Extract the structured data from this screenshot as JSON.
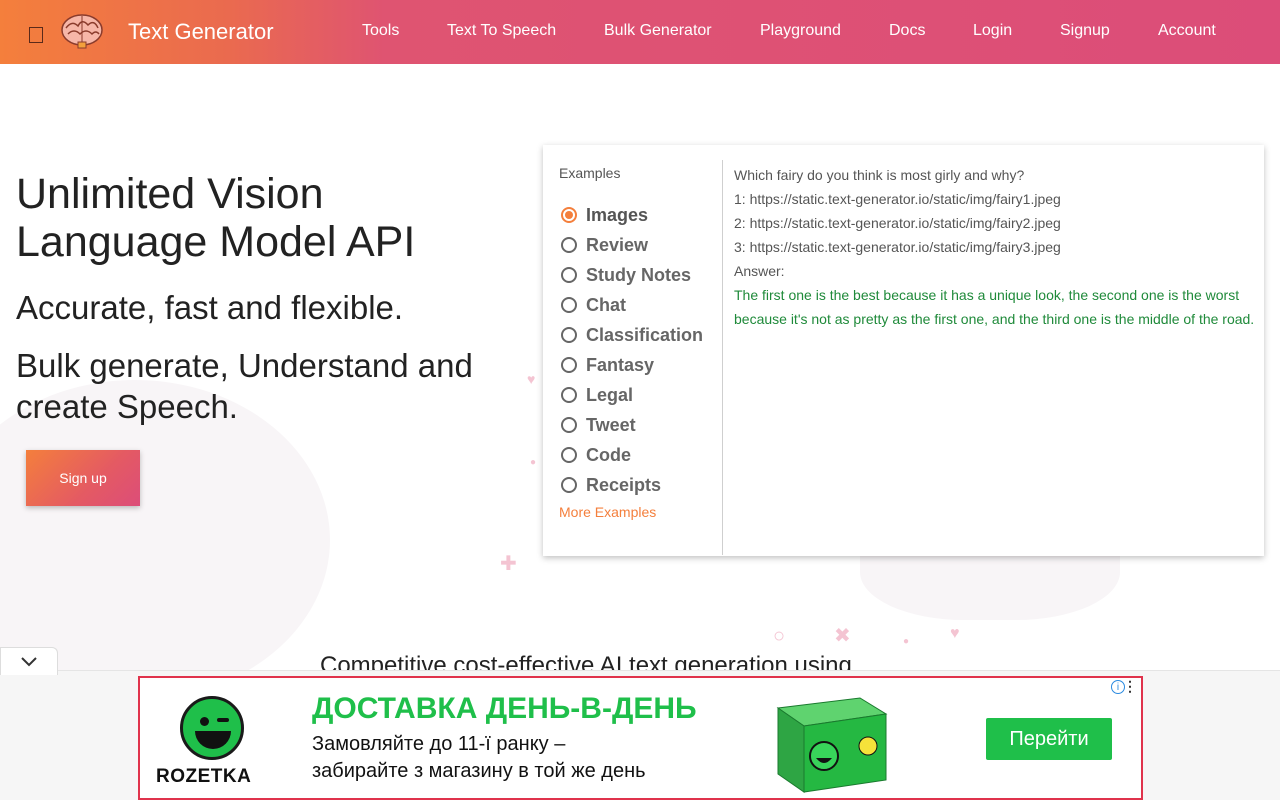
{
  "header": {
    "brand": "Text Generator",
    "nav": [
      {
        "label": "Tools"
      },
      {
        "label": "Text To Speech"
      },
      {
        "label": "Bulk Generator"
      },
      {
        "label": "Playground"
      },
      {
        "label": "Docs"
      },
      {
        "label": "Login"
      },
      {
        "label": "Signup"
      },
      {
        "label": "Account"
      }
    ],
    "menu_glyph": "",
    "colors": {
      "start": "#f47f3c",
      "end": "#dc4d79"
    }
  },
  "hero": {
    "title": "Unlimited Vision Language Model API",
    "subtitle1": "Accurate, fast and flexible.",
    "subtitle2": "Bulk generate, Understand and create Speech.",
    "signup_label": "Sign up"
  },
  "examples": {
    "label": "Examples",
    "options": [
      {
        "label": "Images",
        "checked": true
      },
      {
        "label": "Review",
        "checked": false
      },
      {
        "label": "Study Notes",
        "checked": false
      },
      {
        "label": "Chat",
        "checked": false
      },
      {
        "label": "Classification",
        "checked": false
      },
      {
        "label": "Fantasy",
        "checked": false
      },
      {
        "label": "Legal",
        "checked": false
      },
      {
        "label": "Tweet",
        "checked": false
      },
      {
        "label": "Code",
        "checked": false
      },
      {
        "label": "Receipts",
        "checked": false
      }
    ],
    "more_label": "More Examples",
    "accent": "#f47f3c",
    "prompt_lines": [
      "Which fairy do you think is most girly and why?",
      "1: https://static.text-generator.io/static/img/fairy1.jpeg",
      "2: https://static.text-generator.io/static/img/fairy2.jpeg",
      "3: https://static.text-generator.io/static/img/fairy3.jpeg",
      "Answer:"
    ],
    "answer": "The first one is the best because it has a unique look, the second one is the worst because it's not as pretty as the first one, and the third one is the middle of the road."
  },
  "bottom": {
    "competitive_text": "Competitive cost-effective AI text generation using",
    "collapse_icon": "chevron-down-icon"
  },
  "ad": {
    "brand": "ROZETKA",
    "title": "ДОСТАВКА ДЕНЬ-В-ДЕНЬ",
    "line1": "Замовляйте до 11-ї ранку –",
    "line2": "забирайте з магазину в той же день",
    "cta": "Перейти",
    "info_glyph": "i",
    "accent": "#1fbf4a",
    "border": "#e0334c"
  }
}
